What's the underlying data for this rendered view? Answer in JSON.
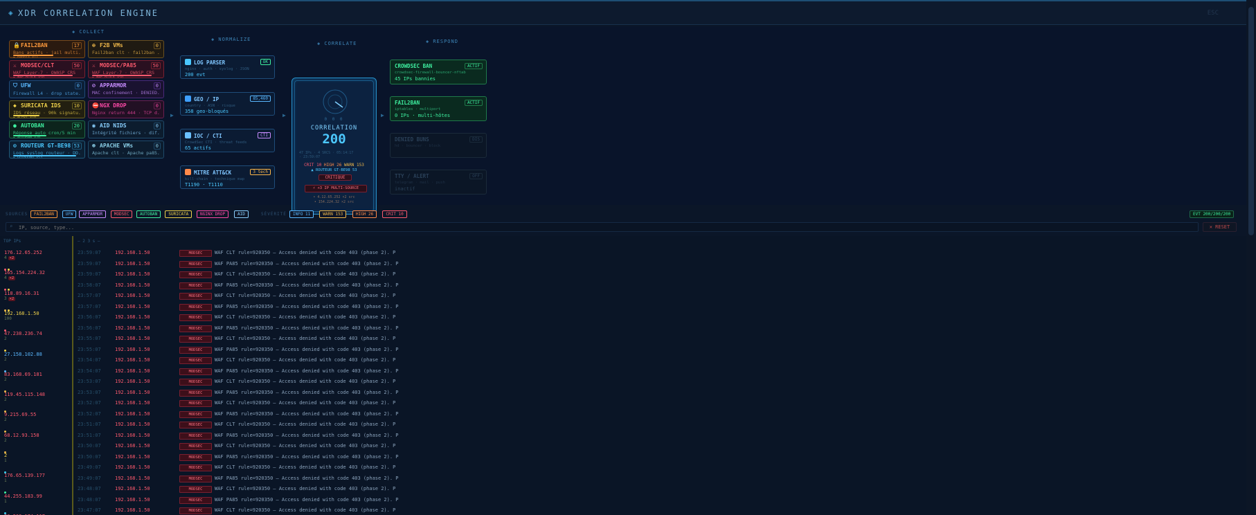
{
  "header": {
    "title": "XDR CORRELATION ENGINE",
    "right": "ESC"
  },
  "columns": {
    "collect": "◈ COLLECT",
    "normalize": "◈ NORMALIZE",
    "correlate": "◈ CORRELATE",
    "respond": "◈ RESPOND"
  },
  "sources": [
    {
      "name": "FAIL2BAN",
      "count": "17",
      "desc": "Bans actifs · jail multi...",
      "extra": "▸ bannis ×11",
      "color": "#ff9a3c",
      "border": "#7a4a1a",
      "bg": "#2a1a10",
      "bar": 0.6,
      "icon": "🔒"
    },
    {
      "name": "F2B VMs",
      "count": "0",
      "desc": "Fail2ban clt · fail2ban ...",
      "extra": "",
      "color": "#f0b84a",
      "border": "#6a5020",
      "bg": "#1f1a12",
      "bar": 0.0,
      "icon": "⊕"
    },
    {
      "name": "MODSEC/CLT",
      "count": "50",
      "desc": "WAF Layer-7 · OWASP CRS",
      "extra": "▸ WAF BLOCK ×50",
      "color": "#ff5a6e",
      "border": "#7a2030",
      "bg": "#2a1020",
      "bar": 0.9,
      "icon": "⚔"
    },
    {
      "name": "MODSEC/PA85",
      "count": "50",
      "desc": "WAF Layer-7 · OWASP CRS",
      "extra": "▸ WAF BLOCK ×50",
      "color": "#ff5a6e",
      "border": "#7a2030",
      "bg": "#2a1020",
      "bar": 0.9,
      "icon": "⚔"
    },
    {
      "name": "UFW",
      "count": "0",
      "desc": "Firewall L4 · drop state...",
      "extra": "",
      "color": "#5ab8ff",
      "border": "#1f4a7a",
      "bg": "#0c1f36",
      "bar": 0.0,
      "icon": "⛉"
    },
    {
      "name": "APPARMOR",
      "count": "0",
      "desc": "MAC confinement · DENIED...",
      "extra": "",
      "color": "#c88cff",
      "border": "#4a2a7a",
      "bg": "#1a1230",
      "bar": 0.0,
      "icon": "⊘"
    },
    {
      "name": "SURICATA IDS",
      "count": "10",
      "desc": "IDS réseau · 90k signatu...",
      "extra": "▸ ALERT ×10",
      "color": "#f0d24a",
      "border": "#6a6020",
      "bg": "#221f10",
      "bar": 0.4,
      "icon": "◆"
    },
    {
      "name": "NGX DROP",
      "count": "0",
      "desc": "Nginx return 444 · TCP d...",
      "extra": "",
      "color": "#ff4aa8",
      "border": "#6a1f50",
      "bg": "#221024",
      "bar": 0.0,
      "icon": "⛔"
    },
    {
      "name": "AUTOBAN",
      "count": "20",
      "desc": "Réponse auto cron/5 min",
      "extra": "▸ AUTOBAN ×20",
      "color": "#3ef0a0",
      "border": "#1f6a4a",
      "bg": "#0c241c",
      "bar": 0.5,
      "icon": "●"
    },
    {
      "name": "AID NIDS",
      "count": "0",
      "desc": "Intégrité fichiers · dif...",
      "extra": "",
      "color": "#8ad0ff",
      "border": "#1f4a6a",
      "bg": "#0c1c2e",
      "bar": 0.0,
      "icon": "◉"
    },
    {
      "name": "ROUTEUR GT-BE98",
      "count": "53",
      "desc": "Logs syslog routeur · DD...",
      "extra": "▸ GUTBOUND ×53",
      "color": "#4ac8ff",
      "border": "#1f5a7a",
      "bg": "#0c1f33",
      "bar": 0.95,
      "icon": "⊙"
    },
    {
      "name": "APACHE VMs",
      "count": "0",
      "desc": "Apache clt · Apache pa85...",
      "extra": "",
      "color": "#8acfe8",
      "border": "#1f4a6a",
      "bg": "#0c1c2e",
      "bar": 0.0,
      "icon": "⊛"
    }
  ],
  "normalize": [
    {
      "name": "LOG PARSER",
      "tag": "OK",
      "sub": "nginx · auth · syslog · JSON",
      "val": "200 evt",
      "tagcolor": "#3ef0a0",
      "iconcolor": "#4ac8ff"
    },
    {
      "name": "GEO / IP",
      "tag": "85,460",
      "sub": "country · ASN · risque",
      "val": "358 geo-bloqués",
      "tagcolor": "#5ab8ff",
      "iconcolor": "#3ea0ff"
    },
    {
      "name": "IOC / CTI",
      "tag": "CTI",
      "sub": "CrowdSec CTI · threat feeds",
      "val": "65 actifs",
      "tagcolor": "#c88cff",
      "iconcolor": "#6ac0ff"
    },
    {
      "name": "MITRE ATT&CK",
      "tag": "3 tech",
      "sub": "kill-chain · technique map",
      "val": "T1190 · T1110",
      "tagcolor": "#ffb84a",
      "iconcolor": "#ff8a4a"
    }
  ],
  "correlation": {
    "dots": "0 0 0",
    "title": "CORRELATION",
    "count": "200",
    "meta1": "47 IPs · 4 SRCS · 05:14:17",
    "meta2": "· 23:59:07",
    "crit_label": "CRIT",
    "crit": "10",
    "high_label": "HIGH",
    "high": "26",
    "warn_label": "WARN",
    "warn": "153",
    "router": "▲ ROUTEUR GT-BE98 53",
    "level": "CRITIQUE",
    "multi": "⚡ +3 IP MULTI-SOURCE",
    "ips": [
      "• 4.12.65.252 ×2 src",
      "• 154.224.32 ×2 src"
    ]
  },
  "respond": [
    {
      "name": "CROWDSEC BAN",
      "tag": "ACTIF",
      "sub": "crowdsec-firewall-bouncer-nftab",
      "val": "45 IPs bannies",
      "color": "#3ef0a0",
      "border": "#1f7a4a",
      "bg": "#0a2a1f"
    },
    {
      "name": "FAIL2BAN",
      "tag": "ACTIF",
      "sub": "iptables · multiport",
      "val": "0 IPs · multi-hôtes",
      "color": "#3ef0a0",
      "border": "#1f7a4a",
      "bg": "#0a2a1f"
    },
    {
      "name": "DENIED BUNS",
      "tag": "DIS",
      "sub": "hd · bouncer · block",
      "val": "",
      "color": "#2a4058",
      "border": "#1a2a3a",
      "bg": "#0b1626"
    },
    {
      "name": "TTY / ALERT",
      "tag": "OFF",
      "sub": "telegram · mail · push",
      "val": "inactif",
      "color": "#2a4058",
      "border": "#1a2a3a",
      "bg": "#0b1626"
    }
  ],
  "filters": {
    "sources_label": "SOURCES",
    "sources": [
      {
        "label": "FAIL2BAN",
        "color": "#ff9a3c"
      },
      {
        "label": "UFW",
        "color": "#5ab8ff"
      },
      {
        "label": "APPARMOR",
        "color": "#c88cff"
      },
      {
        "label": "MODSEC",
        "color": "#ff5a6e"
      },
      {
        "label": "AUTOBAN",
        "color": "#3ef0a0"
      },
      {
        "label": "SURICATA",
        "color": "#f0d24a"
      },
      {
        "label": "NGINX DROP",
        "color": "#ff4aa8"
      },
      {
        "label": "AID",
        "color": "#8ad0ff"
      }
    ],
    "severity_label": "SÉVÉRITÉ",
    "severity": [
      {
        "label": "INFO 11",
        "color": "#5ab8ff"
      },
      {
        "label": "WARN 153",
        "color": "#f0b84a"
      },
      {
        "label": "HIGH 26",
        "color": "#ff8a4a"
      },
      {
        "label": "CRIT 10",
        "color": "#ff5a6e"
      }
    ],
    "evt_count": "EVT 200/200/200"
  },
  "search": {
    "placeholder": "IP, source, type...",
    "reset": "✕ RESET"
  },
  "top_ips": {
    "title": "TOP IPs",
    "items": [
      {
        "ip": "176.12.65.252",
        "count": "4",
        "badge": "×2",
        "color": "#ff5a6e",
        "dots": [
          "#ff5a6e",
          "#f0d24a"
        ]
      },
      {
        "ip": "165.154.224.32",
        "count": "4",
        "badge": "×2",
        "color": "#ff5a6e",
        "dots": [
          "#ff5a6e",
          "#f0d24a"
        ]
      },
      {
        "ip": "118.89.16.31",
        "count": "3",
        "badge": "×2",
        "color": "#ff5a6e",
        "dots": [
          "#f0b84a",
          "#f0d24a"
        ]
      },
      {
        "ip": "192.168.1.50",
        "count": "100",
        "badge": "",
        "color": "#f0d24a",
        "dots": [
          "#ff5a6e"
        ]
      },
      {
        "ip": "47.238.236.74",
        "count": "2",
        "badge": "",
        "color": "#ff5a6e",
        "dots": [
          "#f0d24a"
        ]
      },
      {
        "ip": "27.158.102.88",
        "count": "2",
        "badge": "",
        "color": "#5ab8ff",
        "dots": [
          "#5ab8ff"
        ]
      },
      {
        "ip": "83.168.69.181",
        "count": "2",
        "badge": "",
        "color": "#ff5a6e",
        "dots": [
          "#f0b84a"
        ]
      },
      {
        "ip": "119.45.115.148",
        "count": "2",
        "badge": "",
        "color": "#ff5a6e",
        "dots": [
          "#f0b84a"
        ]
      },
      {
        "ip": "9.215.69.55",
        "count": "2",
        "badge": "",
        "color": "#ff5a6e",
        "dots": [
          "#f0b84a"
        ]
      },
      {
        "ip": "68.12.93.158",
        "count": "2",
        "badge": "",
        "color": "#ff5a6e",
        "dots": [
          "#f0b84a"
        ]
      },
      {
        "ip": "2",
        "count": "1",
        "badge": "",
        "color": "#f0d24a",
        "dots": [
          "#3ed0f0"
        ]
      },
      {
        "ip": "176.65.139.177",
        "count": "1",
        "badge": "",
        "color": "#ff5a6e",
        "dots": [
          "#3ef0a0"
        ]
      },
      {
        "ip": "44.255.183.99",
        "count": "1",
        "badge": "",
        "color": "#ff5a6e",
        "dots": [
          "#3ed0f0"
        ]
      },
      {
        "ip": "20.203.174.117",
        "count": "1",
        "badge": "",
        "color": "#ff5a6e",
        "dots": []
      }
    ]
  },
  "logs": {
    "title": "— 2 3 s —",
    "rows": [
      {
        "ts": "23:59:07",
        "ip": "192.168.1.50",
        "tag": "MODSEC",
        "msg": "WAF CLT rule=920350 — Access denied with code 403 (phase 2). P"
      },
      {
        "ts": "23:59:07",
        "ip": "192.168.1.50",
        "tag": "MODSEC",
        "msg": "WAF PA85 rule=920350 — Access denied with code 403 (phase 2). P"
      },
      {
        "ts": "23:59:07",
        "ip": "192.168.1.50",
        "tag": "MODSEC",
        "msg": "WAF CLT rule=920350 — Access denied with code 403 (phase 2). P"
      },
      {
        "ts": "23:58:07",
        "ip": "192.168.1.50",
        "tag": "MODSEC",
        "msg": "WAF PA85 rule=920350 — Access denied with code 403 (phase 2). P"
      },
      {
        "ts": "23:57:07",
        "ip": "192.168.1.50",
        "tag": "MODSEC",
        "msg": "WAF CLT rule=920350 — Access denied with code 403 (phase 2). P"
      },
      {
        "ts": "23:57:07",
        "ip": "192.168.1.50",
        "tag": "MODSEC",
        "msg": "WAF PA85 rule=920350 — Access denied with code 403 (phase 2). P"
      },
      {
        "ts": "23:56:07",
        "ip": "192.168.1.50",
        "tag": "MODSEC",
        "msg": "WAF CLT rule=920350 — Access denied with code 403 (phase 2). P"
      },
      {
        "ts": "23:56:07",
        "ip": "192.168.1.50",
        "tag": "MODSEC",
        "msg": "WAF PA85 rule=920350 — Access denied with code 403 (phase 2). P"
      },
      {
        "ts": "23:55:07",
        "ip": "192.168.1.50",
        "tag": "MODSEC",
        "msg": "WAF CLT rule=920350 — Access denied with code 403 (phase 2). P"
      },
      {
        "ts": "23:55:07",
        "ip": "192.168.1.50",
        "tag": "MODSEC",
        "msg": "WAF PA85 rule=920350 — Access denied with code 403 (phase 2). P"
      },
      {
        "ts": "23:54:07",
        "ip": "192.168.1.50",
        "tag": "MODSEC",
        "msg": "WAF CLT rule=920350 — Access denied with code 403 (phase 2). P"
      },
      {
        "ts": "23:54:07",
        "ip": "192.168.1.50",
        "tag": "MODSEC",
        "msg": "WAF PA85 rule=920350 — Access denied with code 403 (phase 2). P"
      },
      {
        "ts": "23:53:07",
        "ip": "192.168.1.50",
        "tag": "MODSEC",
        "msg": "WAF CLT rule=920350 — Access denied with code 403 (phase 2). P"
      },
      {
        "ts": "23:53:07",
        "ip": "192.168.1.50",
        "tag": "MODSEC",
        "msg": "WAF PA85 rule=920350 — Access denied with code 403 (phase 2). P"
      },
      {
        "ts": "23:52:07",
        "ip": "192.168.1.50",
        "tag": "MODSEC",
        "msg": "WAF CLT rule=920350 — Access denied with code 403 (phase 2). P"
      },
      {
        "ts": "23:52:07",
        "ip": "192.168.1.50",
        "tag": "MODSEC",
        "msg": "WAF PA85 rule=920350 — Access denied with code 403 (phase 2). P"
      },
      {
        "ts": "23:51:07",
        "ip": "192.168.1.50",
        "tag": "MODSEC",
        "msg": "WAF CLT rule=920350 — Access denied with code 403 (phase 2). P"
      },
      {
        "ts": "23:51:07",
        "ip": "192.168.1.50",
        "tag": "MODSEC",
        "msg": "WAF PA85 rule=920350 — Access denied with code 403 (phase 2). P"
      },
      {
        "ts": "23:50:07",
        "ip": "192.168.1.50",
        "tag": "MODSEC",
        "msg": "WAF CLT rule=920350 — Access denied with code 403 (phase 2). P"
      },
      {
        "ts": "23:50:07",
        "ip": "192.168.1.50",
        "tag": "MODSEC",
        "msg": "WAF PA85 rule=920350 — Access denied with code 403 (phase 2). P"
      },
      {
        "ts": "23:49:07",
        "ip": "192.168.1.50",
        "tag": "MODSEC",
        "msg": "WAF CLT rule=920350 — Access denied with code 403 (phase 2). P"
      },
      {
        "ts": "23:49:07",
        "ip": "192.168.1.50",
        "tag": "MODSEC",
        "msg": "WAF PA85 rule=920350 — Access denied with code 403 (phase 2). P"
      },
      {
        "ts": "23:48:07",
        "ip": "192.168.1.50",
        "tag": "MODSEC",
        "msg": "WAF CLT rule=920350 — Access denied with code 403 (phase 2). P"
      },
      {
        "ts": "23:48:07",
        "ip": "192.168.1.50",
        "tag": "MODSEC",
        "msg": "WAF PA85 rule=920350 — Access denied with code 403 (phase 2). P"
      },
      {
        "ts": "23:47:07",
        "ip": "192.168.1.50",
        "tag": "MODSEC",
        "msg": "WAF CLT rule=920350 — Access denied with code 403 (phase 2). P"
      }
    ]
  }
}
